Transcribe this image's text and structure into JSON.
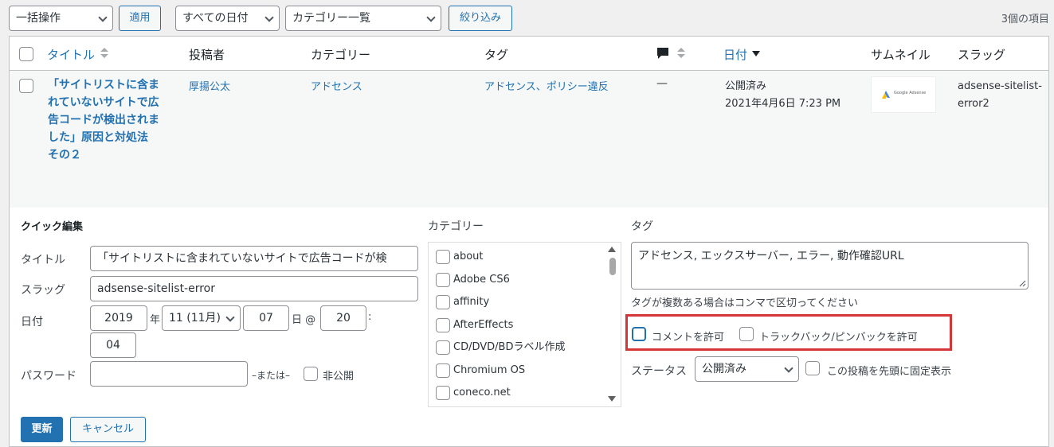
{
  "toolbar": {
    "bulk_action": "一括操作",
    "apply": "適用",
    "date_filter": "すべての日付",
    "category_filter": "カテゴリー一覧",
    "filter": "絞り込み",
    "items_count": "3個の項目"
  },
  "columns": {
    "title": "タイトル",
    "author": "投稿者",
    "categories": "カテゴリー",
    "tags": "タグ",
    "date": "日付",
    "thumbnail": "サムネイル",
    "slug": "スラッグ"
  },
  "row": {
    "title_lines": [
      "「サイトリストに含ま",
      "れていないサイトで広",
      "告コードが検出されま",
      "した」原因と対処法",
      "その２"
    ],
    "author": "厚揚公太",
    "category": "アドセンス",
    "tags": "アドセンス、ポリシー違反",
    "comments": "—",
    "status": "公開済み",
    "date": "2021年4月6日 7:23 PM",
    "thumbnail_text": "Google Adsense",
    "slug_lines": [
      "adsense-sitelist-",
      "error2"
    ]
  },
  "quick_edit": {
    "heading": "クイック編集",
    "title_label": "タイトル",
    "title_value": "「サイトリストに含まれていないサイトで広告コードが検",
    "slug_label": "スラッグ",
    "slug_value": "adsense-sitelist-error",
    "date_label": "日付",
    "year": "2019",
    "year_suffix": "年",
    "month": "11 (11月)",
    "day": "07",
    "day_suffix": "日 @",
    "hour": "20",
    "colon": ":",
    "minute": "04",
    "password_label": "パスワード",
    "password_value": "",
    "or_label": "–または–",
    "private_label": "非公開",
    "categories_heading": "カテゴリー",
    "categories": [
      "about",
      "Adobe CS6",
      "affinity",
      "AfterEffects",
      "CD/DVD/BDラベル作成",
      "Chromium OS",
      "coneco.net"
    ],
    "tags_heading": "タグ",
    "tags_value": "アドセンス, エックスサーバー, エラー, 動作確認URL",
    "tags_hint": "タグが複数ある場合はコンマで区切ってください",
    "allow_comments": "コメントを許可",
    "allow_pings": "トラックバック/ピンバックを許可",
    "status_label": "ステータス",
    "status_value": "公開済み",
    "sticky_label": "この投稿を先頭に固定表示",
    "update_button": "更新",
    "cancel_button": "キャンセル"
  },
  "colors": {
    "accent": "#2271b1",
    "highlight_box": "#d63638",
    "row_bg": "#f6f7f7"
  }
}
